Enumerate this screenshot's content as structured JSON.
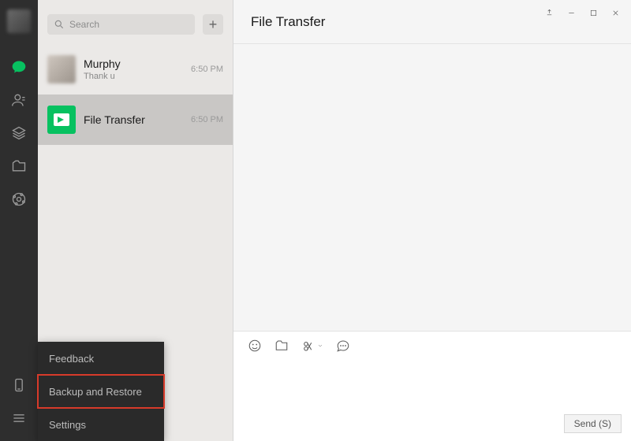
{
  "search": {
    "placeholder": "Search"
  },
  "conversations": [
    {
      "name": "Murphy",
      "preview": "Thank u",
      "time": "6:50 PM"
    },
    {
      "name": "File Transfer",
      "preview": "",
      "time": "6:50 PM"
    }
  ],
  "chat": {
    "title": "File Transfer",
    "send_label": "Send (S)"
  },
  "popup": {
    "feedback": "Feedback",
    "backup": "Backup and Restore",
    "settings": "Settings"
  },
  "icons": {
    "chat": "chat-icon",
    "contacts": "contacts-icon",
    "favorites": "favorites-icon",
    "files": "files-icon",
    "mini": "miniprogram-icon",
    "phone": "phone-icon",
    "menu": "menu-icon",
    "pin": "pin-icon",
    "min": "minimize-icon",
    "max": "maximize-icon",
    "close": "close-icon",
    "emoji": "emoji-icon",
    "folder": "folder-icon",
    "snip": "screenshot-icon",
    "history": "chat-history-icon",
    "search": "search-icon",
    "plus": "plus-icon"
  }
}
